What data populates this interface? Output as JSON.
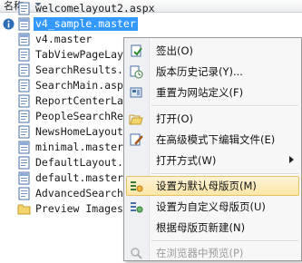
{
  "header": {
    "column_title": "名称"
  },
  "files": [
    {
      "name": "welcomelayout2.aspx",
      "selected": false,
      "icon": "aspx-file-icon"
    },
    {
      "name": "v4_sample.master",
      "selected": true,
      "icon": "master-file-icon"
    },
    {
      "name": "v4.master",
      "selected": false,
      "icon": "master-file-icon"
    },
    {
      "name": "TabViewPageLayou",
      "selected": false,
      "icon": "aspx-file-icon"
    },
    {
      "name": "SearchResults.as",
      "selected": false,
      "icon": "aspx-file-icon"
    },
    {
      "name": "SearchMain.aspx",
      "selected": false,
      "icon": "aspx-file-icon"
    },
    {
      "name": "ReportCenterLayo",
      "selected": false,
      "icon": "aspx-file-icon"
    },
    {
      "name": "PeopleSearchResu",
      "selected": false,
      "icon": "aspx-file-icon"
    },
    {
      "name": "NewsHomeLayout.as",
      "selected": false,
      "icon": "aspx-file-icon"
    },
    {
      "name": "minimal.master",
      "selected": false,
      "icon": "master-file-icon"
    },
    {
      "name": "DefaultLayout.as",
      "selected": false,
      "icon": "aspx-file-icon"
    },
    {
      "name": "default.master",
      "selected": false,
      "icon": "master-file-icon"
    },
    {
      "name": "AdvancedSearchLa",
      "selected": false,
      "icon": "aspx-file-icon"
    },
    {
      "name": "Preview Images",
      "selected": false,
      "icon": "folder-icon"
    }
  ],
  "context_menu": {
    "items": [
      {
        "label": "签出(O)",
        "icon": "check-out-icon",
        "disabled": false,
        "highlighted": false
      },
      {
        "label": "版本历史记录(Y)...",
        "icon": "version-history-icon",
        "disabled": false,
        "highlighted": false
      },
      {
        "label": "重置为网站定义(F)",
        "icon": "reset-site-definition-icon",
        "disabled": false,
        "highlighted": false
      },
      {
        "label": "打开(O)",
        "icon": "open-folder-icon",
        "disabled": false,
        "highlighted": false
      },
      {
        "label": "在高级模式下编辑文件(E)",
        "icon": "edit-advanced-icon",
        "disabled": false,
        "highlighted": false
      },
      {
        "label": "打开方式(W)",
        "icon": "",
        "disabled": false,
        "highlighted": false,
        "submenu": true
      },
      {
        "label": "设置为默认母版页(M)",
        "icon": "set-default-master-icon",
        "disabled": false,
        "highlighted": true
      },
      {
        "label": "设置为自定义母版页(U)",
        "icon": "set-custom-master-icon",
        "disabled": false,
        "highlighted": false
      },
      {
        "label": "根据母版页新建(N)",
        "icon": "",
        "disabled": false,
        "highlighted": false
      },
      {
        "label": "在浏览器中预览(P)",
        "icon": "preview-browser-icon",
        "disabled": true,
        "highlighted": false
      }
    ]
  },
  "colors": {
    "selection": "#3399ff",
    "menu_highlight": "#fbe6a7",
    "menu_highlight_border": "#e5c365",
    "disabled_text": "#9b9b9b"
  }
}
